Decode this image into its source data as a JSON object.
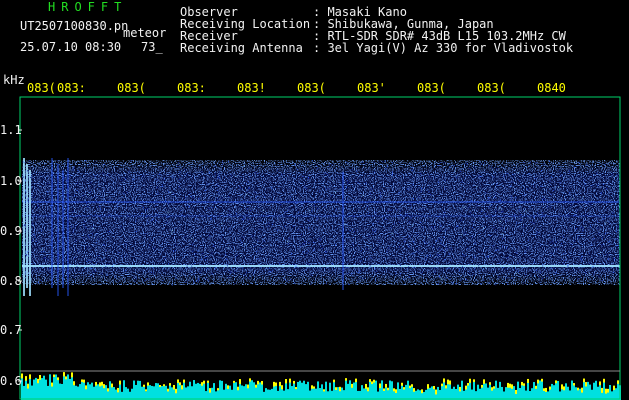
{
  "header": {
    "brand": "HROFFT",
    "filename": "UT2507100830.pn",
    "mode": "meteor",
    "datetime": "25.07.10 08:30",
    "count": "73_",
    "info": [
      {
        "label": "Observer",
        "value": ": Masaki Kano"
      },
      {
        "label": "Receiving Location",
        "value": ": Shibukawa, Gunma, Japan"
      },
      {
        "label": "Receiver",
        "value": ": RTL-SDR SDR# 43dB L15 103.2MHz CW"
      },
      {
        "label": "Receiving Antenna",
        "value": ": 3el Yagi(V) Az 330 for Vladivostok"
      }
    ]
  },
  "axes": {
    "unit": "kHz",
    "time_ticks": [
      "083(",
      "083:",
      "083(",
      "083:",
      "083!",
      "083(",
      "083'",
      "083(",
      "083(",
      "0840"
    ],
    "freq_ticks": [
      "1.1",
      "1.0",
      "0.9",
      "0.8",
      "0.7",
      "0.6"
    ]
  },
  "colors": {
    "background": "#000000",
    "frame": "#00d26a",
    "header_title": "#22dd22",
    "header_text": "#f2f2f2",
    "time_labels": "#ffff00",
    "noise_low": "#0a1aa0",
    "noise_mid": "#2a5cff",
    "noise_high": "#9fe0ff",
    "power_bar": "#00e0e0",
    "power_peak": "#ffff00"
  }
}
